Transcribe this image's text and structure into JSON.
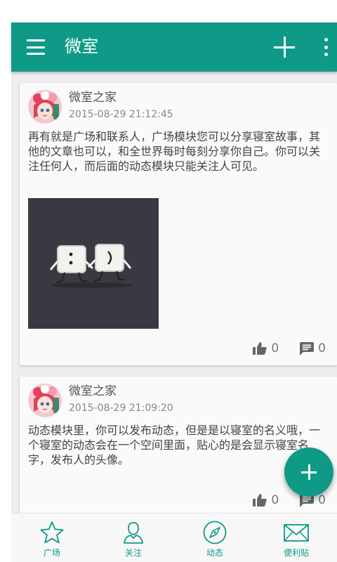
{
  "app": {
    "title": "微室"
  },
  "colors": {
    "primary": "#0f9a88",
    "background": "#eeeeee"
  },
  "icons": {
    "appbar": [
      "menu-icon",
      "add-icon",
      "more-vert-icon"
    ],
    "fab": "add-icon",
    "post_actions": [
      "thumb-up-icon",
      "comment-icon"
    ]
  },
  "posts": [
    {
      "author": "微室之家",
      "time": "2015-08-29 21:12:45",
      "text": "再有就是广场和联系人，广场模块您可以分享寝室故事，其他的文章也可以，和全世界每时每刻分享你自己。你可以关注任何人，而后面的动态模块只能关注人可见。",
      "likes": "0",
      "comments": "0"
    },
    {
      "author": "微室之家",
      "time": "2015-08-29 21:09:20",
      "text": "动态模块里，你可以发布动态，但是是以寝室的名义哦，一个寝室的动态会在一个空间里面，贴心的是会显示寝室名字，发布人的头像。",
      "likes": "0",
      "comments": "0"
    }
  ],
  "nav": {
    "items": [
      {
        "label": "广场",
        "icon": "star-icon"
      },
      {
        "label": "关注",
        "icon": "person-icon"
      },
      {
        "label": "动态",
        "icon": "compass-icon"
      },
      {
        "label": "便利贴",
        "icon": "mail-icon"
      }
    ]
  }
}
